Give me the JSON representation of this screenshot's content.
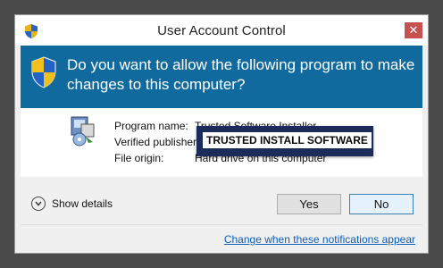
{
  "window": {
    "title": "User Account Control",
    "close_label": "✕"
  },
  "header": {
    "question": "Do you want to allow the following program to make changes to this computer?"
  },
  "details": {
    "program_name_label": "Program name:",
    "program_name_value": "Trusted Software Installer",
    "publisher_label": "Verified publisher:",
    "publisher_value": "TRUSTED INSTALL SOFTWARE",
    "origin_label": "File origin:",
    "origin_value": "Hard drive on this computer"
  },
  "footer": {
    "show_details_label": "Show details",
    "yes_label": "Yes",
    "no_label": "No",
    "settings_link": "Change when these notifications appear"
  },
  "colors": {
    "header_bg": "#116a9e",
    "overlay_bg": "#1b2c5b",
    "link": "#0b5fb5"
  },
  "icons": [
    "uac-shield-icon",
    "installer-icon",
    "chevron-down-icon",
    "close-icon"
  ]
}
